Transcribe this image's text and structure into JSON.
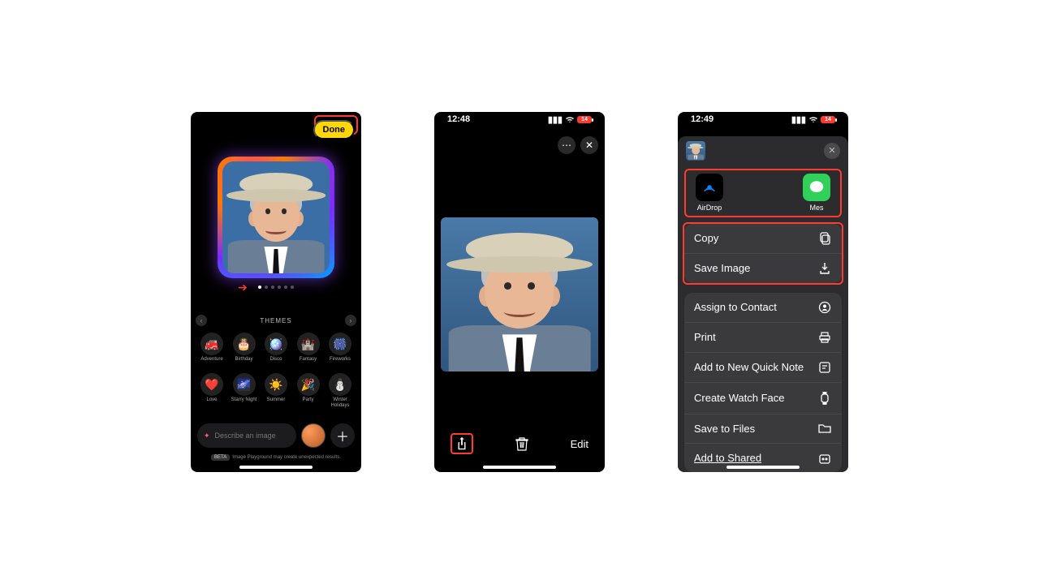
{
  "colors": {
    "highlight": "#ff3b30",
    "accent": "#ffd60a"
  },
  "phone1": {
    "done_label": "Done",
    "themes_title": "THEMES",
    "themes_row1": [
      {
        "label": "Adventure",
        "emoji": "🚒"
      },
      {
        "label": "Birthday",
        "emoji": "🎂"
      },
      {
        "label": "Disco",
        "emoji": "🪩"
      },
      {
        "label": "Fantasy",
        "emoji": "🏰"
      },
      {
        "label": "Fireworks",
        "emoji": "🎆"
      }
    ],
    "themes_row2": [
      {
        "label": "Love",
        "emoji": "❤️"
      },
      {
        "label": "Starry Night",
        "emoji": "🌌"
      },
      {
        "label": "Summer",
        "emoji": "☀️"
      },
      {
        "label": "Party",
        "emoji": "🎉"
      },
      {
        "label": "Winter Holidays",
        "emoji": "⛄"
      }
    ],
    "prompt_placeholder": "Describe an image",
    "beta_badge": "BETA",
    "disclaimer": "Image Playground may create unexpected results.",
    "page_dots": 6,
    "active_dot": 0
  },
  "phone2": {
    "time": "12:48",
    "battery": "14",
    "edit_label": "Edit"
  },
  "phone3": {
    "time": "12:49",
    "battery": "14",
    "share_apps": [
      {
        "name": "AirDrop",
        "icon": "airdrop",
        "bg": "#000000"
      },
      {
        "name": "Mes",
        "icon": "messages",
        "bg": "#30d158",
        "cut": true
      }
    ],
    "actions_group1": [
      {
        "label": "Copy",
        "icon": "copy"
      },
      {
        "label": "Save Image",
        "icon": "download"
      }
    ],
    "actions_group2": [
      {
        "label": "Assign to Contact",
        "icon": "contact"
      },
      {
        "label": "Print",
        "icon": "print"
      },
      {
        "label": "Add to New Quick Note",
        "icon": "note"
      },
      {
        "label": "Create Watch Face",
        "icon": "watch"
      },
      {
        "label": "Save to Files",
        "icon": "folder"
      },
      {
        "label": "Add to Shared",
        "icon": "shared",
        "underline": true
      }
    ]
  }
}
